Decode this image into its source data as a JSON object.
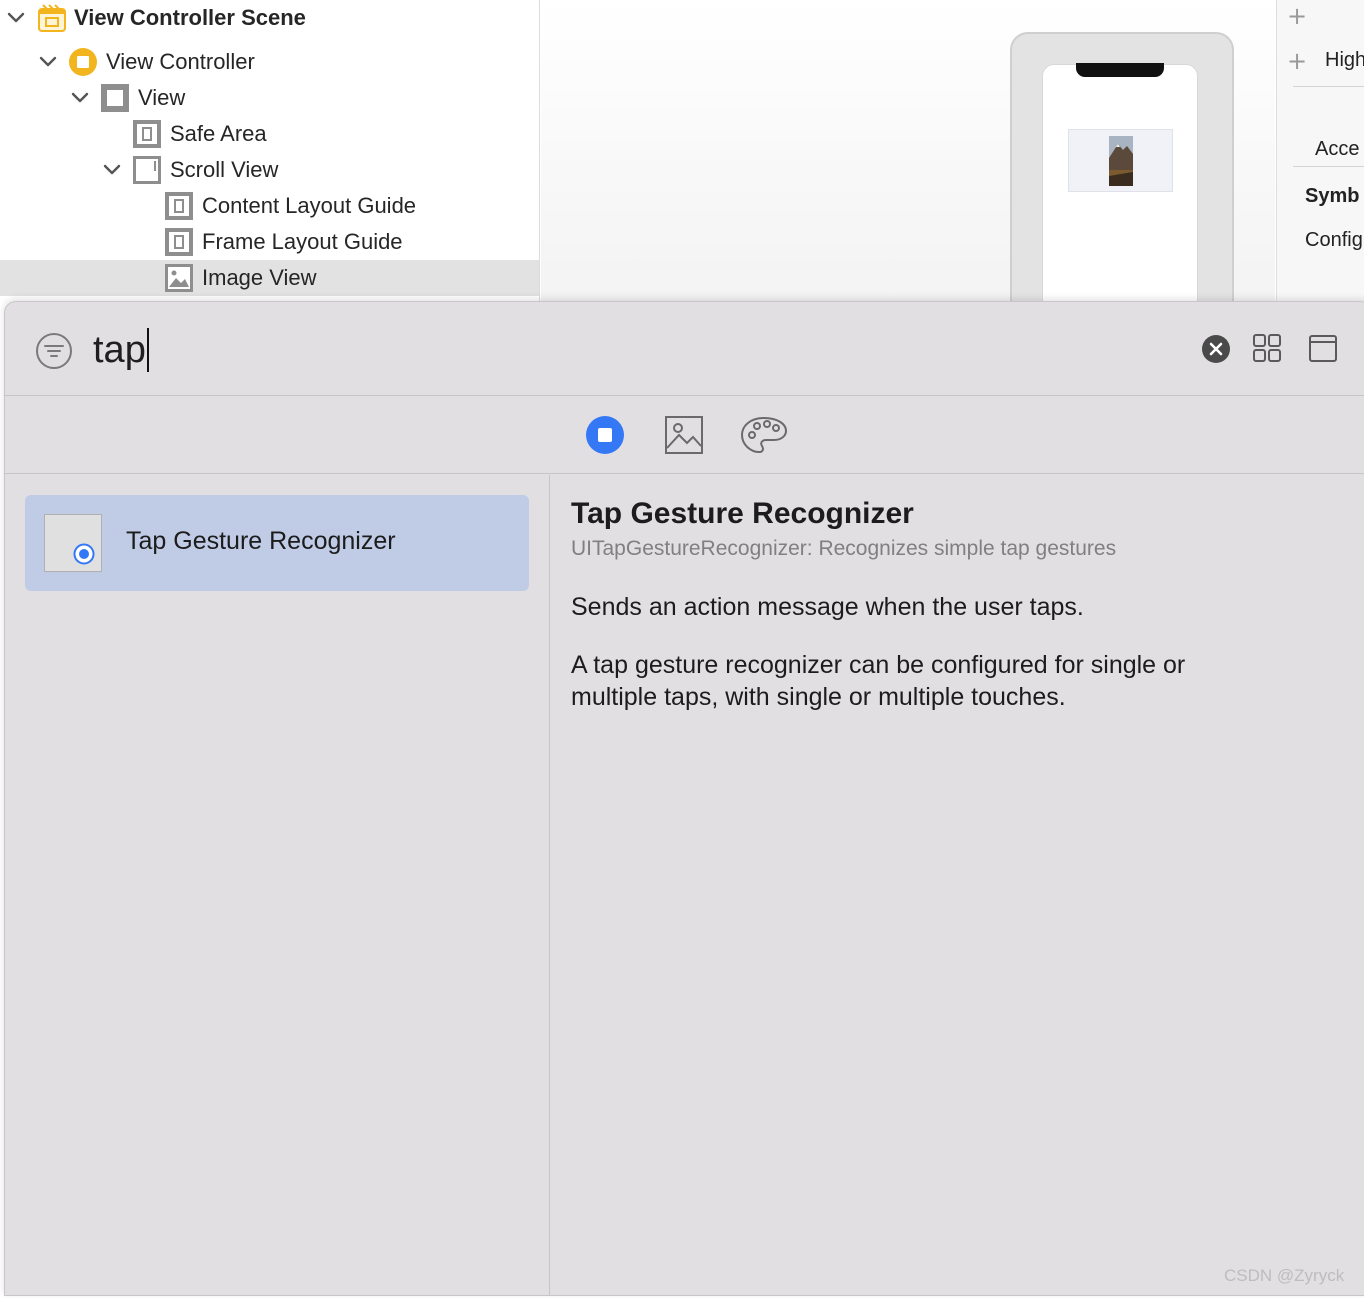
{
  "outline": {
    "items": [
      {
        "label": "View Controller Scene",
        "icon": "scene-icon"
      },
      {
        "label": "View Controller",
        "icon": "view-controller-icon"
      },
      {
        "label": "View",
        "icon": "view-icon"
      },
      {
        "label": "Safe Area",
        "icon": "layout-guide-icon"
      },
      {
        "label": "Scroll View",
        "icon": "scroll-view-icon"
      },
      {
        "label": "Content Layout Guide",
        "icon": "layout-guide-icon"
      },
      {
        "label": "Frame Layout Guide",
        "icon": "layout-guide-icon"
      },
      {
        "label": "Image View",
        "icon": "image-view-icon"
      }
    ]
  },
  "inspector": {
    "items": [
      {
        "label": "High"
      },
      {
        "label": "Acce"
      },
      {
        "label": "Symb"
      },
      {
        "label": "Config"
      }
    ]
  },
  "library": {
    "search": {
      "value": "tap"
    },
    "tabs": [
      {
        "name": "objects",
        "icon": "objects-icon"
      },
      {
        "name": "media",
        "icon": "image-icon"
      },
      {
        "name": "colors",
        "icon": "palette-icon"
      }
    ],
    "results": [
      {
        "label": "Tap Gesture Recognizer"
      }
    ],
    "detail": {
      "title": "Tap Gesture Recognizer",
      "subtitle": "UITapGestureRecognizer: Recognizes simple tap gestures",
      "summary": "Sends an action message when the user taps.",
      "description": "A tap gesture recognizer can be configured for single or multiple taps, with single or multiple touches."
    }
  },
  "watermark": "CSDN @Zyryck",
  "colors": {
    "accent": "#3478f6",
    "selection": "#c0cbe6",
    "panel": "#e2dfe3",
    "scene_icon": "#f2b51e"
  }
}
